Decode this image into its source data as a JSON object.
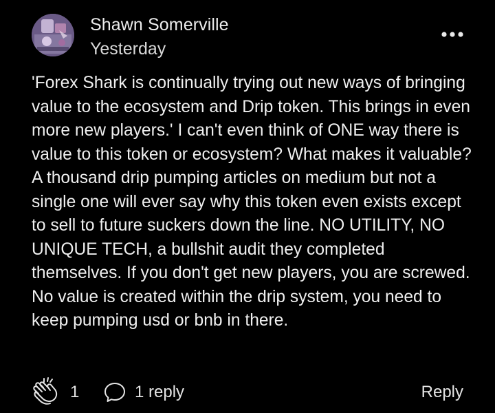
{
  "comment": {
    "author": "Shawn Somerville",
    "timestamp": "Yesterday",
    "body": "'Forex Shark is continually trying out new ways of bringing value to the ecosystem and Drip token. This brings in even more new players.' I can't even think of ONE way there is value to this token or ecosystem? What makes it valuable? A thousand drip pumping articles on medium but not a single one will ever say why this token even exists except to sell to future suckers down the line. NO UTILITY, NO UNIQUE TECH, a bullshit audit they completed themselves. If you don't get new players, you are screwed. No value is created within the drip system, you need to keep pumping usd or bnb in there.",
    "more_icon": "more-horizontal-icon",
    "avatar": "user-avatar"
  },
  "actions": {
    "clap_icon": "clap-icon",
    "clap_count": "1",
    "reply_icon": "speech-bubble-icon",
    "replies_label": "1 reply",
    "reply_label": "Reply"
  },
  "colors": {
    "background": "#000000",
    "text": "#efefef"
  }
}
